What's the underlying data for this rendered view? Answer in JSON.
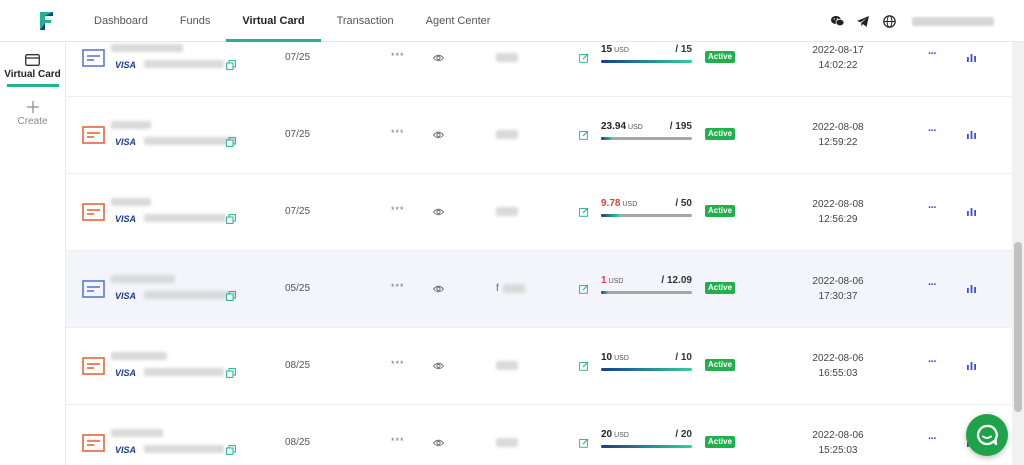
{
  "nav": {
    "items": [
      "Dashboard",
      "Funds",
      "Virtual Card",
      "Transaction",
      "Agent Center"
    ],
    "active_index": 2
  },
  "sidebar": {
    "virtual_card_label": "Virtual Card",
    "create_label": "Create"
  },
  "colors": {
    "accent": "#1fb295",
    "active_badge": "#21b04b",
    "card_blue": "#5b78d6",
    "card_orange": "#e8663c",
    "low_balance": "#e24040",
    "chat": "#1fa34a"
  },
  "currency_label": "USD",
  "cvv_mask": "***",
  "card_brand": "VISA",
  "rows": [
    {
      "card_color": "blue",
      "expiry": "07/25",
      "prefix": "",
      "balance": "15",
      "limit": "/ 15",
      "usage": 0.0,
      "status": "Active",
      "date": "2022-08-17",
      "time": "14:02:22",
      "low": false
    },
    {
      "card_color": "orange",
      "expiry": "07/25",
      "prefix": "",
      "balance": "23.94",
      "limit": "/ 195",
      "usage": 0.12,
      "status": "Active",
      "date": "2022-08-08",
      "time": "12:59:22",
      "low": false
    },
    {
      "card_color": "orange",
      "expiry": "07/25",
      "prefix": "",
      "balance": "9.78",
      "limit": "/ 50",
      "usage": 0.2,
      "status": "Active",
      "date": "2022-08-08",
      "time": "12:56:29",
      "low": true
    },
    {
      "card_color": "blue",
      "expiry": "05/25",
      "prefix": "f",
      "balance": "1",
      "limit": "/ 12.09",
      "usage": 0.08,
      "status": "Active",
      "date": "2022-08-06",
      "time": "17:30:37",
      "low": true
    },
    {
      "card_color": "orange",
      "expiry": "08/25",
      "prefix": "",
      "balance": "10",
      "limit": "/ 10",
      "usage": 0.0,
      "status": "Active",
      "date": "2022-08-06",
      "time": "16:55:03",
      "low": false
    },
    {
      "card_color": "orange",
      "expiry": "08/25",
      "prefix": "",
      "balance": "20",
      "limit": "/ 20",
      "usage": 0.0,
      "status": "Active",
      "date": "2022-08-06",
      "time": "15:25:03",
      "low": false
    }
  ],
  "icons": {
    "logo": "logo-icon",
    "wechat": "wechat-icon",
    "telegram": "telegram-icon",
    "language": "globe-icon",
    "card": "card-icon",
    "create": "plus-icon",
    "copy": "copy-icon",
    "eye": "eye-icon",
    "edit": "edit-icon",
    "more": "more-icon",
    "stats": "bar-chart-icon",
    "chat": "chat-icon"
  }
}
